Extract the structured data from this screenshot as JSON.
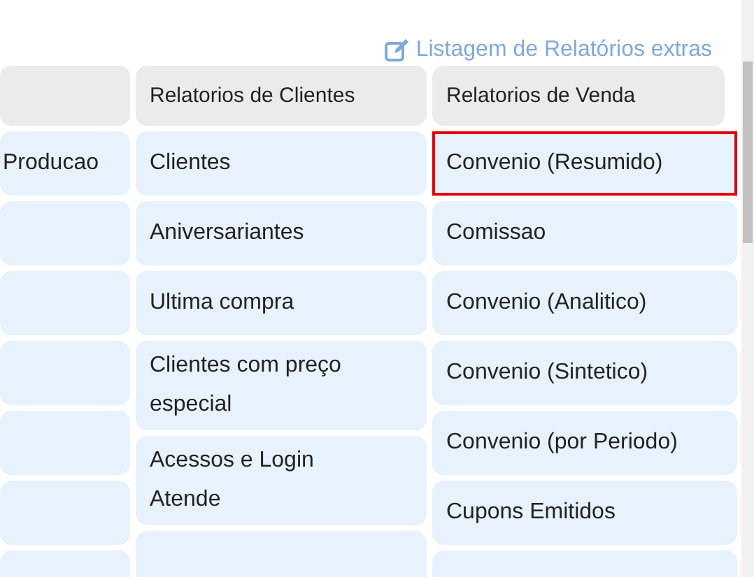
{
  "extras_link": {
    "label": "Listagem de Relatórios extras"
  },
  "columns": [
    {
      "items": [
        {
          "label": "Producao",
          "highlighted": false
        },
        {
          "highlighted": false
        },
        {
          "highlighted": false
        },
        {
          "highlighted": false
        },
        {
          "highlighted": false
        },
        {
          "highlighted": false
        },
        {
          "highlighted": false
        }
      ]
    },
    {
      "header": "Relatorios de Clientes",
      "items": [
        {
          "label": "Clientes",
          "highlighted": false
        },
        {
          "label": "Aniversariantes",
          "highlighted": false
        },
        {
          "label": "Ultima compra",
          "highlighted": false
        },
        {
          "label": "Clientes com preço especial",
          "highlighted": false
        },
        {
          "label": "Acessos e Login Atende",
          "highlighted": false
        },
        {
          "highlighted": false
        }
      ]
    },
    {
      "header": "Relatorios de Venda",
      "items": [
        {
          "label": "Convenio (Resumido)",
          "highlighted": true
        },
        {
          "label": "Comissao",
          "highlighted": false
        },
        {
          "label": "Convenio (Analitico)",
          "highlighted": false
        },
        {
          "label": "Convenio (Sintetico)",
          "highlighted": false
        },
        {
          "label": "Convenio (por Periodo)",
          "highlighted": false
        },
        {
          "label": "Cupons Emitidos",
          "highlighted": false
        },
        {
          "highlighted": false
        }
      ]
    }
  ]
}
